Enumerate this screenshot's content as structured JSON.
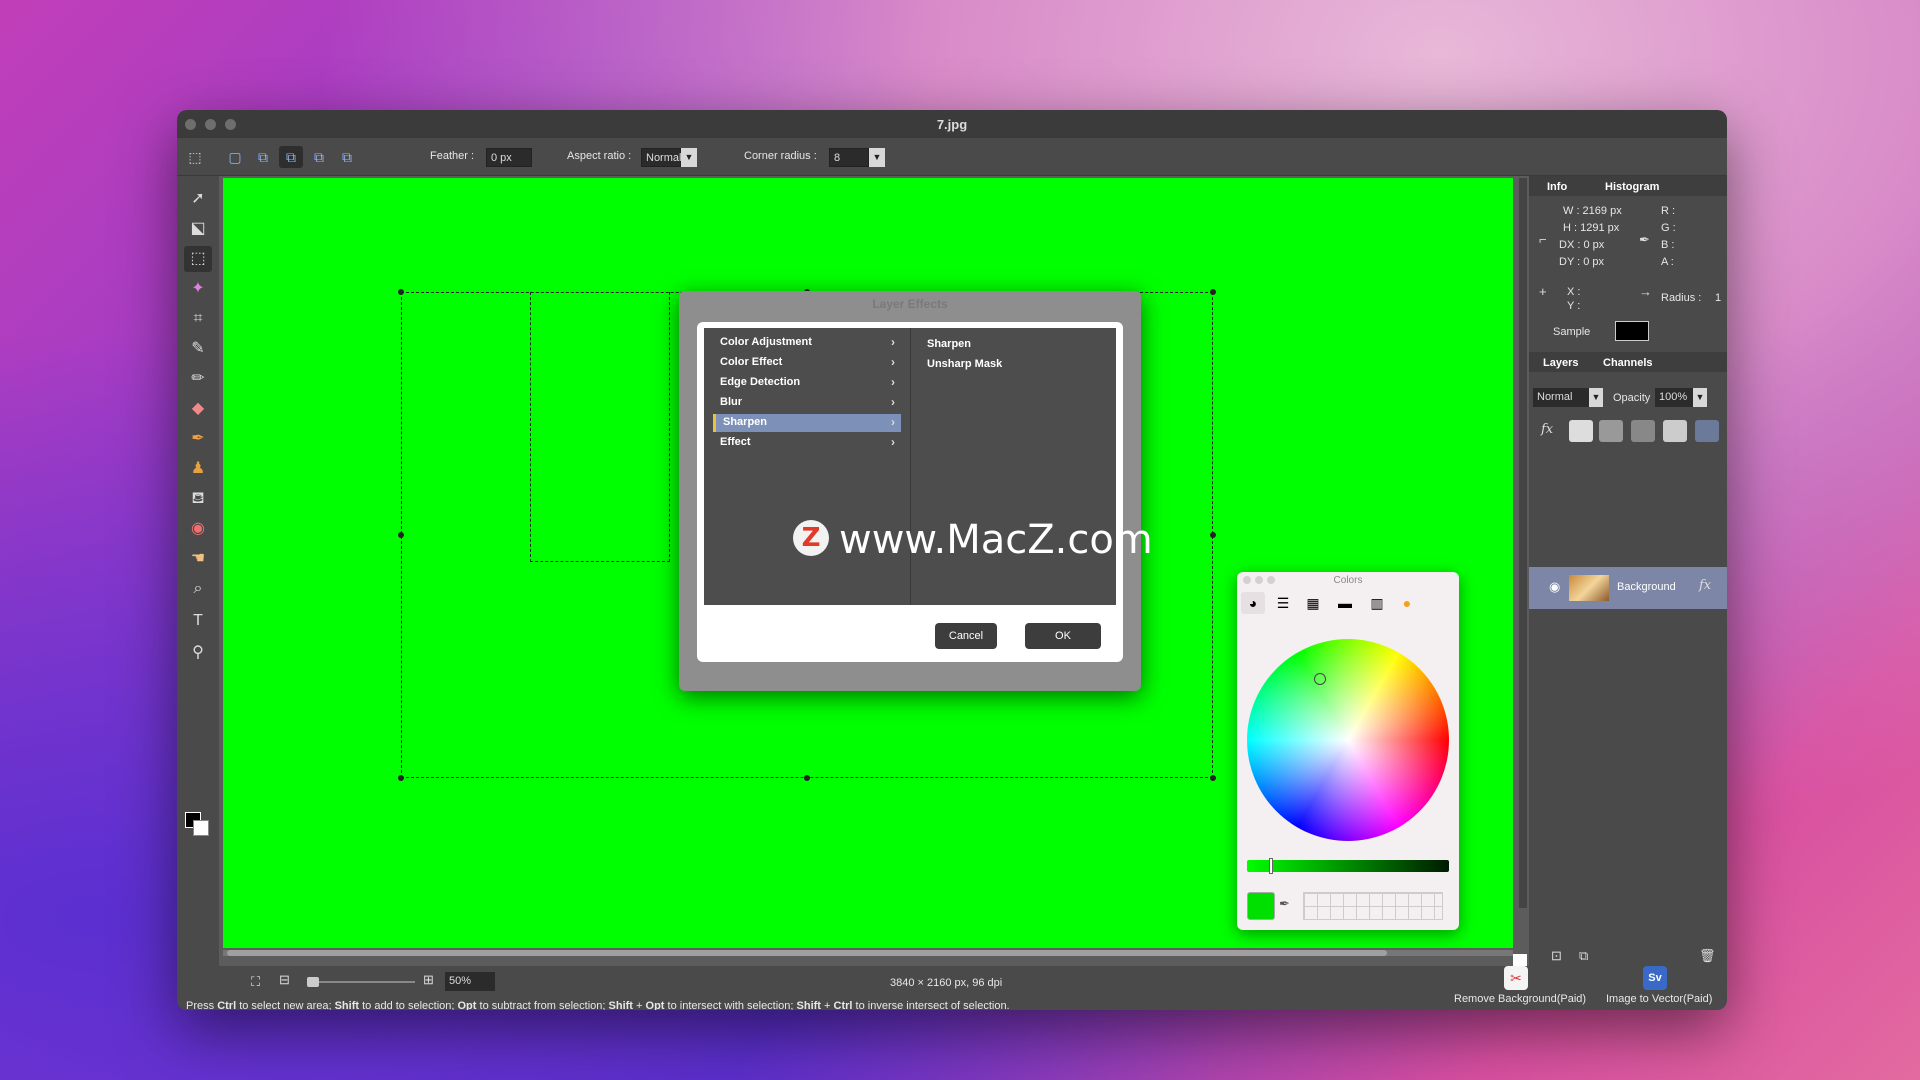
{
  "window": {
    "title": "7.jpg"
  },
  "options_bar": {
    "feather_label": "Feather :",
    "feather_value": "0 px",
    "aspect_label": "Aspect ratio :",
    "aspect_value": "Normal",
    "corner_label": "Corner radius :",
    "corner_value": "8"
  },
  "dialog": {
    "title": "Layer Effects",
    "categories": [
      {
        "label": "Color Adjustment"
      },
      {
        "label": "Color Effect"
      },
      {
        "label": "Edge Detection"
      },
      {
        "label": "Blur"
      },
      {
        "label": "Sharpen"
      },
      {
        "label": "Effect"
      }
    ],
    "selected": "Sharpen",
    "sub_items": [
      "Sharpen",
      "Unsharp Mask"
    ],
    "cancel": "Cancel",
    "ok": "OK"
  },
  "watermark": {
    "logo": "Z",
    "text": "www.MacZ.com"
  },
  "colors_panel": {
    "title": "Colors",
    "current_color": "#00e000"
  },
  "info_panel": {
    "tab_info": "Info",
    "tab_histogram": "Histogram",
    "w": "W :  2169 px",
    "h": "H :  1291 px",
    "dx": "DX :  0 px",
    "dy": "DY :  0 px",
    "r": "R :",
    "g": "G :",
    "b": "B :",
    "a": "A :",
    "x": "X :",
    "y": "Y :",
    "radius_label": "Radius :",
    "radius_value": "1",
    "sample_label": "Sample"
  },
  "layers_panel": {
    "tab_layers": "Layers",
    "tab_channels": "Channels",
    "blend_mode": "Normal",
    "opacity_label": "Opacity",
    "opacity_value": "100%",
    "layer_name": "Background"
  },
  "status": {
    "zoom": "50%",
    "dimensions": "3840 × 2160 px, 96 dpi",
    "hint_parts": [
      "Press ",
      "Ctrl",
      " to select new area; ",
      "Shift",
      " to add to selection; ",
      "Opt",
      " to subtract from selection; ",
      "Shift",
      " + ",
      "Opt",
      " to intersect with selection; ",
      "Shift",
      " + ",
      "Ctrl",
      " to inverse intersect of selection."
    ],
    "remove_bg": "Remove Background(Paid)",
    "to_vector": "Image to Vector(Paid)",
    "to_vector_badge": "Sv"
  },
  "colors": {
    "canvas": "#00ff00",
    "accent": "#7c90b8",
    "highlight": "#e8c33a"
  }
}
